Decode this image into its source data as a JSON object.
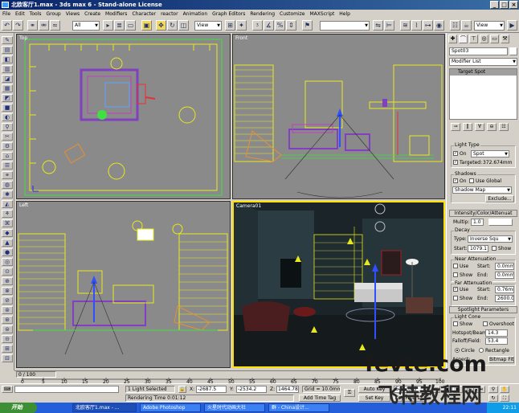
{
  "window": {
    "title": "北欧客厅1.max - 3ds max 6 - Stand-alone License"
  },
  "menu": [
    "File",
    "Edit",
    "Tools",
    "Group",
    "Views",
    "Create",
    "Modifiers",
    "Character",
    "reactor",
    "Animation",
    "Graph Editors",
    "Rendering",
    "Customize",
    "MAXScript",
    "Help"
  ],
  "toolbar": {
    "selection_filter": "All",
    "ref_coord": "View",
    "named_selection": "",
    "right_view": "View"
  },
  "viewports": {
    "top": "Top",
    "front": "Front",
    "left": "Left",
    "camera": "Camera01"
  },
  "command_panel": {
    "object_name": "Spot03",
    "modifier_list": "Modifier List",
    "stack_item": "Target Spot",
    "light_type": {
      "header": "Light Type",
      "on_label": "On",
      "type_value": "Spot",
      "targeted_label": "Targeted:",
      "targeted_value": "372.674mm"
    },
    "shadows": {
      "header": "Shadows",
      "on_label": "On",
      "use_global_label": "Use Global",
      "type_value": "Shadow Map",
      "exclude_button": "Exclude..."
    },
    "intensity": {
      "rollout": "Intensity/Color/Attenuat",
      "multiplier_label": "Multip:",
      "multiplier_value": "1.0",
      "decay_header": "Decay",
      "type_label": "Type:",
      "type_value": "Inverse Squ",
      "start_label": "Start:",
      "start_value": "1079.1",
      "show_label": "Show"
    },
    "near_atten": {
      "header": "Near Attenuation",
      "use_label": "Use",
      "start_label": "Start:",
      "start_value": "0.0mm",
      "show_label": "Show",
      "end_label": "End:",
      "end_value": "0.0mm"
    },
    "far_atten": {
      "header": "Far Attenuation",
      "use_label": "Use",
      "start_label": "Start:",
      "start_value": "0.76mm",
      "show_label": "Show",
      "end_label": "End:",
      "end_value": "2600.0"
    },
    "spotlight": {
      "rollout": "Spotlight Parameters",
      "cone_header": "Light Cone",
      "show_label": "Show",
      "overshoot_label": "Overshoot",
      "hotspot_label": "Hotspot/Beam:",
      "hotspot_value": "14.3",
      "falloff_label": "Falloff/Field:",
      "falloff_value": "53.4",
      "circle_label": "Circle",
      "rect_label": "Rectangle",
      "aspect_label": "Aspect:",
      "bitmap_button": "Bitmap Fit"
    }
  },
  "timeline": {
    "frame_readout": "0 / 100",
    "ticks": [
      "0",
      "5",
      "10",
      "15",
      "20",
      "25",
      "30",
      "35",
      "40",
      "45",
      "50",
      "55",
      "60",
      "65",
      "70",
      "75",
      "80",
      "85",
      "90",
      "95",
      "100"
    ]
  },
  "status": {
    "selection": "1 Light Selected",
    "x_label": "X:",
    "x_value": "-2687.5",
    "y_label": "Y:",
    "y_value": "-2534.2",
    "z_label": "Z:",
    "z_value": "1464.78",
    "grid": "Grid = 10.0mm",
    "render_time": "Rendering Time  0:01:12",
    "add_time_tag": "Add Time Tag",
    "auto_key": "Auto Key",
    "set_key": "Set Key",
    "selected": "Selected",
    "key_filters": "Key Filters..."
  },
  "taskbar": {
    "start": "开始",
    "tasks": [
      "北欧客厅1.max - ...",
      "Adobe Photoshop",
      "火星时代动画大社",
      "群 - China设计..."
    ],
    "clock": "22:11"
  },
  "watermark": {
    "line1": "fevte.com",
    "line2": "飞特教程网"
  },
  "colors": {
    "title_bar": "#0a246a",
    "viewport_bg": "#8a8a8a",
    "active_viewport_border": "#ffe000",
    "wireframe_yellow": "#e8e820",
    "wireframe_green": "#40e040",
    "wireframe_purple": "#8040c0",
    "taskbar": "#245edb"
  }
}
